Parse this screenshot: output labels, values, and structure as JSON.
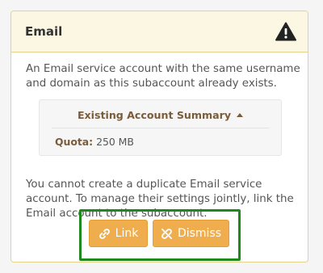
{
  "panel": {
    "title": "Email",
    "icon": "warning-icon"
  },
  "message_top": "An Email service account with the same username and domain as this subaccount already exists.",
  "summary": {
    "heading": "Existing Account Summary",
    "toggle_icon": "caret-up-icon",
    "quota_label": "Quota:",
    "quota_value": "250 MB"
  },
  "message_bottom": "You cannot create a duplicate Email service account. To manage their settings jointly, link the Email account to the subaccount.",
  "actions": {
    "link_label": "Link",
    "link_icon": "link-icon",
    "dismiss_label": "Dismiss",
    "dismiss_icon": "unlink-icon"
  },
  "colors": {
    "panel_border": "#e6d28a",
    "panel_header_bg": "#fcf7e3",
    "button_bg": "#f0ad4e",
    "highlight_border": "#1e8a1e"
  }
}
